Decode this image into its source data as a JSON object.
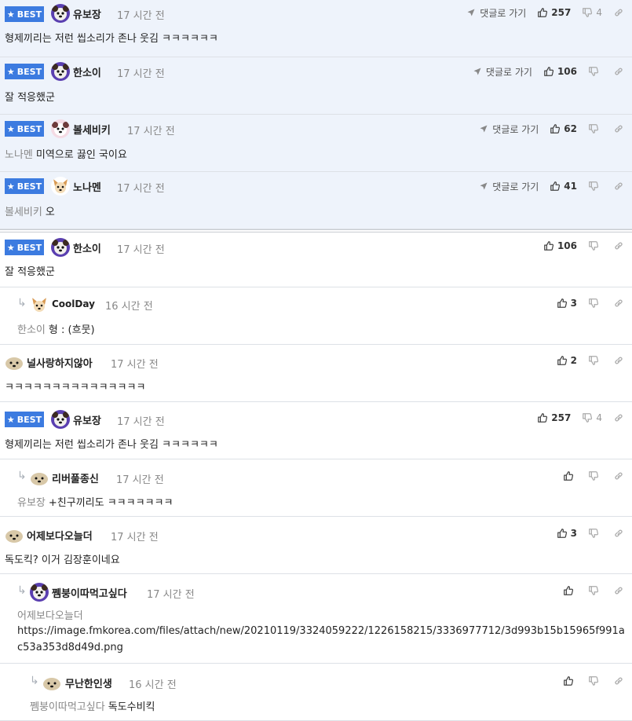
{
  "labels": {
    "best": "BEST",
    "goto": "댓글로 가기"
  },
  "colors": {
    "best_bg": "#eef3fb",
    "badge": "#3c7be0"
  },
  "best_comments": [
    {
      "nick": "유보장",
      "time": "17 시간 전",
      "text": "형제끼리는 저런 씹소리가 존나 웃김 ㅋㅋㅋㅋㅋㅋ",
      "up": "257",
      "down": "4",
      "avatar": "dog-face"
    },
    {
      "nick": "한소이",
      "time": "17 시간 전",
      "text": "잘 적응했군",
      "up": "106",
      "down": "",
      "avatar": "dog-face"
    },
    {
      "nick": "볼세비키",
      "time": "17 시간 전",
      "ref": "노나멘",
      "text": "미역으로 끓인 국이요",
      "up": "62",
      "down": "",
      "avatar": "dog-face-pink"
    },
    {
      "nick": "노나멘",
      "time": "17 시간 전",
      "ref": "볼세비키",
      "text": "오",
      "up": "41",
      "down": "",
      "avatar": "dog-face-cream"
    }
  ],
  "comments": [
    {
      "best": true,
      "nick": "한소이",
      "time": "17 시간 전",
      "text": "잘 적응했군",
      "up": "106",
      "down": ""
    },
    {
      "nick": "CoolDay",
      "time": "16 시간 전",
      "ref": "한소이",
      "text": "형 : (흐뭇)",
      "up": "3",
      "down": ""
    },
    {
      "nick": "널사랑하지않아",
      "time": "17 시간 전",
      "text": "ㅋㅋㅋㅋㅋㅋㅋㅋㅋㅋㅋㅋㅋㅋㅋ",
      "up": "2",
      "down": ""
    },
    {
      "best": true,
      "nick": "유보장",
      "time": "17 시간 전",
      "text": "형제끼리는 저런 씹소리가 존나 웃김 ㅋㅋㅋㅋㅋㅋ",
      "up": "257",
      "down": "4"
    },
    {
      "nick": "리버풀종신",
      "time": "17 시간 전",
      "ref": "유보장",
      "text": "+친구끼리도 ㅋㅋㅋㅋㅋㅋㅋ",
      "up": "",
      "down": ""
    },
    {
      "nick": "어제보다오늘더",
      "time": "17 시간 전",
      "text": "독도킥? 이거 김장훈이네요",
      "up": "3",
      "down": ""
    },
    {
      "nick": "쩸붕이따먹고싶다",
      "time": "17 시간 전",
      "ref": "어제보다오늘더",
      "text": "https://image.fmkorea.com/files/attach/new/20210119/3324059222/1226158215/3336977712/3d993b15b15965f991ac53a353d8d49d.png",
      "up": "",
      "down": ""
    },
    {
      "nick": "무난한인생",
      "time": "16 시간 전",
      "ref": "쩸붕이따먹고싶다",
      "text": "독도수비킥",
      "up": "",
      "down": ""
    }
  ]
}
